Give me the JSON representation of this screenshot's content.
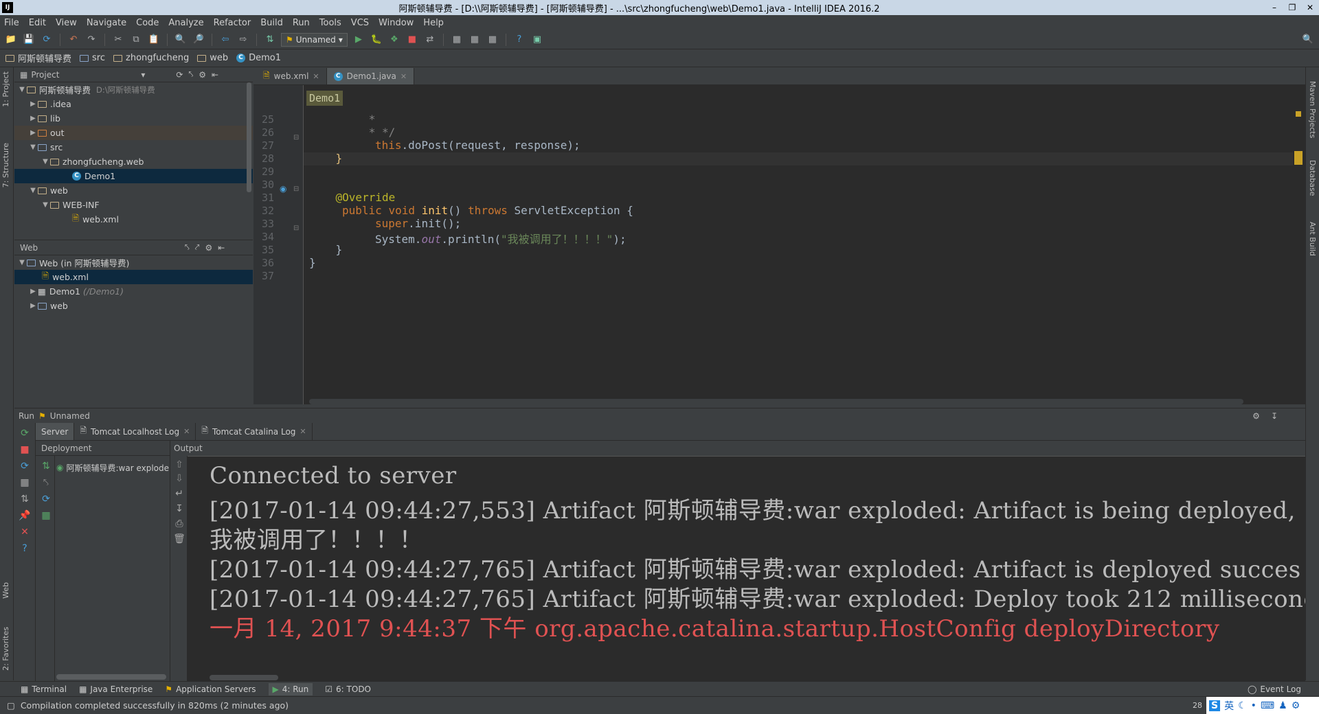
{
  "window": {
    "title": "阿斯顿辅导费 - [D:\\\\阿斯顿辅导费] - [阿斯顿辅导费] - ...\\src\\zhongfucheng\\web\\Demo1.java - IntelliJ IDEA 2016.2",
    "logo": "IJ"
  },
  "menu": [
    "File",
    "Edit",
    "View",
    "Navigate",
    "Code",
    "Analyze",
    "Refactor",
    "Build",
    "Run",
    "Tools",
    "VCS",
    "Window",
    "Help"
  ],
  "toolbar": {
    "run_config": "Unnamed"
  },
  "breadcrumb": [
    "阿斯顿辅导费",
    "src",
    "zhongfucheng",
    "web",
    "Demo1"
  ],
  "left_strip": {
    "project": "1: Project",
    "structure": "7: Structure",
    "web": "Web",
    "favorites": "2: Favorites"
  },
  "right_strip": {
    "maven": "Maven Projects",
    "database": "Database",
    "ant": "Ant Build"
  },
  "project_panel": {
    "title": "Project",
    "root": "阿斯顿辅导费",
    "root_path": "D:\\阿斯顿辅导费",
    "items": [
      ".idea",
      "lib",
      "out",
      "src",
      "zhongfucheng.web",
      "Demo1",
      "web",
      "WEB-INF",
      "web.xml"
    ]
  },
  "web_panel": {
    "title": "Web",
    "root": "Web (in 阿斯顿辅导费)",
    "items": [
      "web.xml",
      "Demo1",
      "(/Demo1)",
      "web"
    ]
  },
  "editor": {
    "tabs": [
      "web.xml",
      "Demo1.java"
    ],
    "badge": "Demo1",
    "line_numbers": [
      "25",
      "26",
      "27",
      "28",
      "29",
      "30",
      "31",
      "32",
      "33",
      "34",
      "35",
      "36",
      "37"
    ],
    "lines": {
      "l25": "         *",
      "l26": "         * */",
      "l27_kw": "this",
      "l27_rest": ".doPost(request, response);",
      "l28": "    }",
      "l31": "    @Override",
      "l32_kw1": "public",
      "l32_kw2": "void",
      "l32_fn": "init",
      "l32_mid": "()",
      "l32_kw3": "throws",
      "l32_rest": "ServletException {",
      "l33_kw": "super",
      "l33_rest": ".init();",
      "l34_a": "System.",
      "l34_out": "out",
      "l34_b": ".println(",
      "l34_str": "\"我被调用了！！！！\"",
      "l34_c": ");",
      "l35": "    }",
      "l36": "}"
    }
  },
  "run_window": {
    "header": "Run",
    "config": "Unnamed",
    "tabs": [
      "Server",
      "Tomcat Localhost Log",
      "Tomcat Catalina Log"
    ],
    "deployment_title": "Deployment",
    "deployment_item": "阿斯顿辅导费:war explode",
    "output_title": "Output",
    "output_lines": [
      "Connected to server",
      "[2017-01-14 09:44:27,553] Artifact 阿斯顿辅导费:war exploded: Artifact is being deployed,",
      "我被调用了！！！！",
      "[2017-01-14 09:44:27,765] Artifact 阿斯顿辅导费:war exploded: Artifact is deployed succes",
      "[2017-01-14 09:44:27,765] Artifact 阿斯顿辅导费:war exploded: Deploy took 212 milliseconc",
      "一月 14, 2017 9:44:37 下午 org.apache.catalina.startup.HostConfig deployDirectory"
    ]
  },
  "bottom_tabs": [
    "Terminal",
    "Java Enterprise",
    "Application Servers",
    "4: Run",
    "6: TODO"
  ],
  "event_log": "Event Log",
  "status": "Compilation completed successfully in 820ms (2 minutes ago)",
  "status_right": "28",
  "ime": {
    "lang": "英"
  },
  "colors": {
    "keyword": "#cc7832",
    "annotation": "#bbb529",
    "string": "#6a8759",
    "error_text": "#e05252",
    "selection": "#0d293e"
  }
}
